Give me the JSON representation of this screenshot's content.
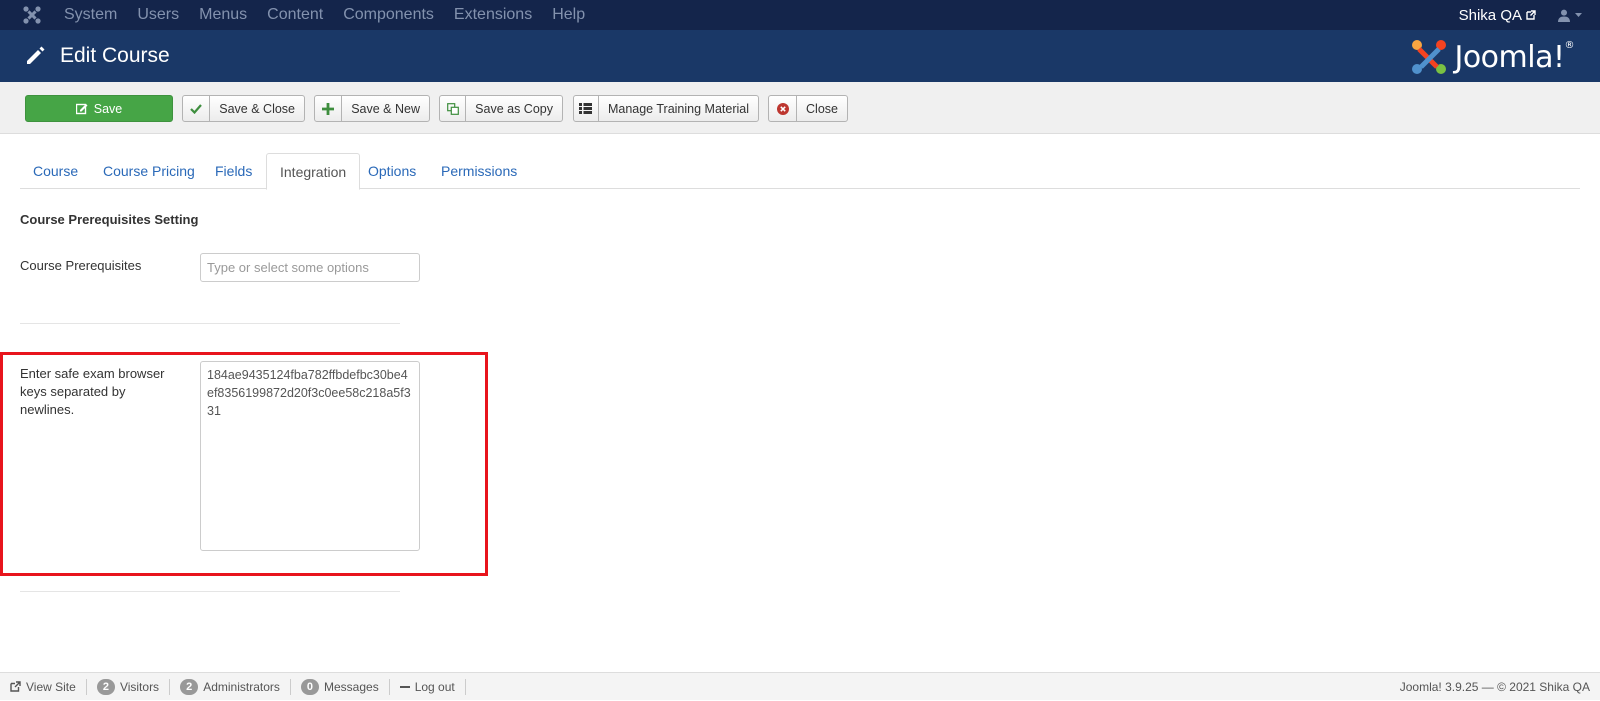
{
  "topnav": {
    "logo_icon": "joomla-icon",
    "items": [
      "System",
      "Users",
      "Menus",
      "Content",
      "Components",
      "Extensions",
      "Help"
    ],
    "site_name": "Shika QA",
    "user_icon": "user-icon"
  },
  "header": {
    "title": "Edit Course",
    "title_icon": "pencil-icon",
    "brand": "Joomla!",
    "brand_mark": "®"
  },
  "toolbar": {
    "save": "Save",
    "save_close": "Save & Close",
    "save_new": "Save & New",
    "save_copy": "Save as Copy",
    "manage_training": "Manage Training Material",
    "close": "Close"
  },
  "tabs": [
    "Course",
    "Course Pricing",
    "Fields",
    "Integration",
    "Options",
    "Permissions"
  ],
  "active_tab": "Integration",
  "form": {
    "section_title": "Course Prerequisites Setting",
    "prerequisites_label": "Course Prerequisites",
    "prerequisites_placeholder": "Type or select some options",
    "seb_label": "Enter safe exam browser keys separated by newlines.",
    "seb_value": "184ae9435124fba782ffbdefbc30be4ef8356199872d20f3c0ee58c218a5f331"
  },
  "statusbar": {
    "view_site": "View Site",
    "visitors_count": "2",
    "visitors_label": "Visitors",
    "admins_count": "2",
    "admins_label": "Administrators",
    "messages_count": "0",
    "messages_label": "Messages",
    "logout": "Log out",
    "version": "Joomla! 3.9.25  —  © 2021 Shika QA"
  },
  "colors": {
    "topnav_bg": "#14254b",
    "header_bg": "#1a3867",
    "save_green": "#46a546",
    "highlight_red": "#e8141c",
    "link_blue": "#2a69b8"
  }
}
